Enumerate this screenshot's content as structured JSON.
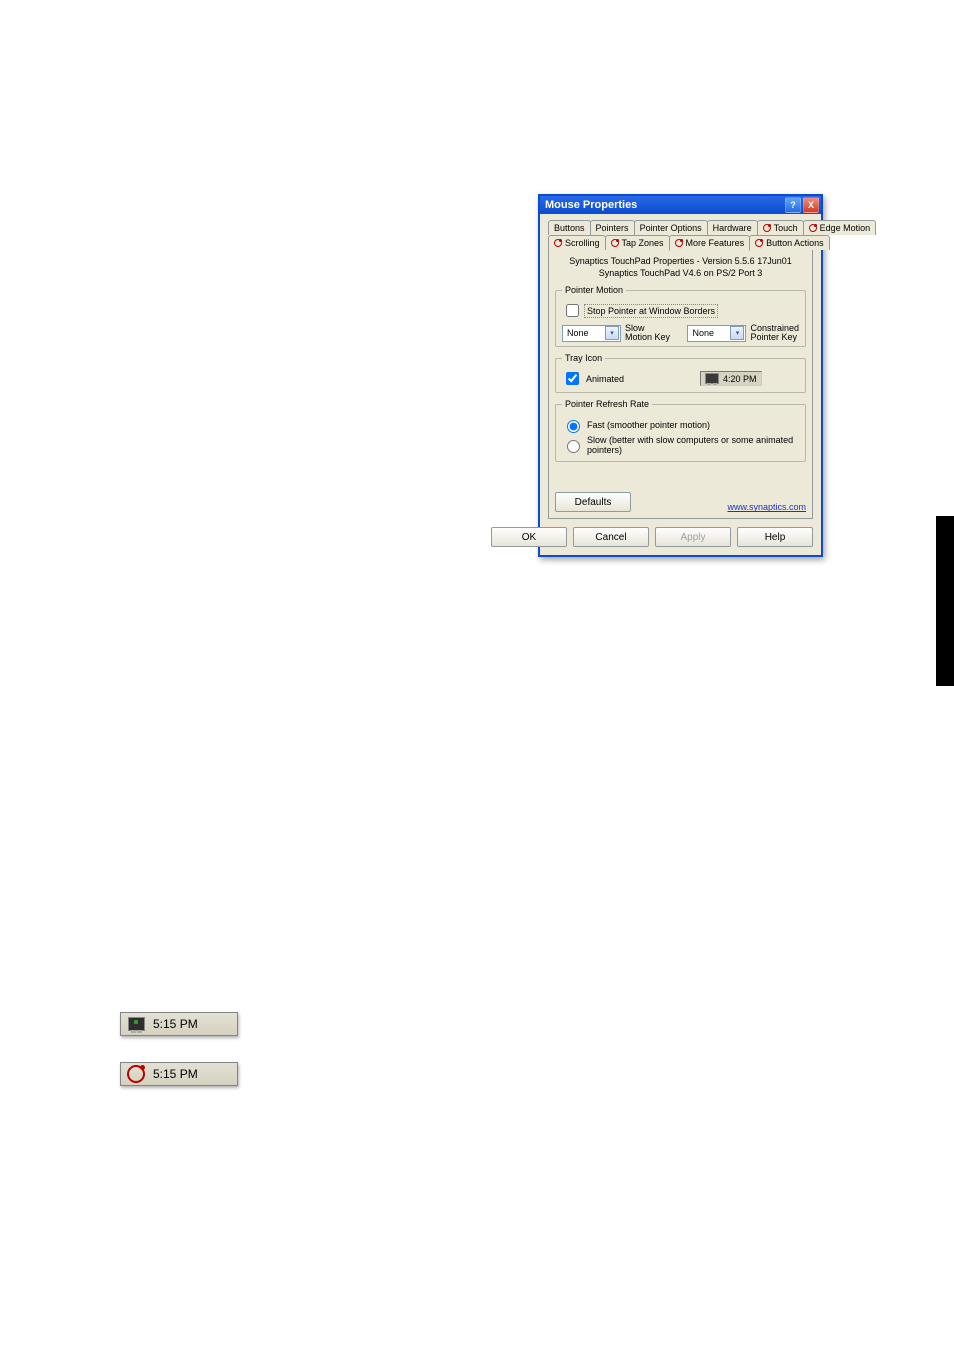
{
  "dialog": {
    "title": "Mouse Properties",
    "help_btn": "?",
    "close_btn": "X",
    "tabs_row1": [
      {
        "label": "Buttons",
        "syn": false
      },
      {
        "label": "Pointers",
        "syn": false
      },
      {
        "label": "Pointer Options",
        "syn": false
      },
      {
        "label": "Hardware",
        "syn": false
      },
      {
        "label": "Touch",
        "syn": true
      },
      {
        "label": "Edge Motion",
        "syn": true
      }
    ],
    "tabs_row2": [
      {
        "label": "Scrolling",
        "syn": true
      },
      {
        "label": "Tap Zones",
        "syn": true
      },
      {
        "label": "More Features",
        "syn": true,
        "active": true
      },
      {
        "label": "Button Actions",
        "syn": true
      }
    ],
    "info1": "Synaptics TouchPad Properties - Version 5.5.6 17Jun01",
    "info2": "Synaptics TouchPad V4.6 on PS/2 Port 3",
    "group_pm": {
      "legend": "Pointer Motion",
      "stop_at_borders": "Stop Pointer at Window Borders",
      "combo1": "None",
      "combo1_lbl_a": "Slow",
      "combo1_lbl_b": "Motion Key",
      "combo2": "None",
      "combo2_lbl_a": "Constrained",
      "combo2_lbl_b": "Pointer Key"
    },
    "group_tray": {
      "legend": "Tray Icon",
      "animated": "Animated",
      "time": "4:20 PM"
    },
    "group_prr": {
      "legend": "Pointer Refresh Rate",
      "opt_fast": "Fast (smoother pointer motion)",
      "opt_slow": "Slow (better with slow computers or some animated pointers)"
    },
    "defaults_btn": "Defaults",
    "link": "www.synaptics.com",
    "ok": "OK",
    "cancel": "Cancel",
    "apply": "Apply",
    "help": "Help"
  },
  "tray_examples": {
    "t1": "5:15 PM",
    "t2": "5:15 PM"
  }
}
